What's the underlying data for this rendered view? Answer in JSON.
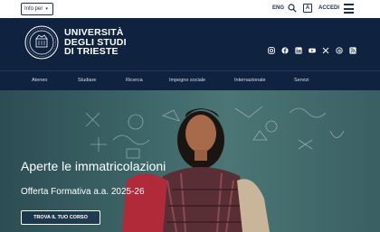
{
  "topbar": {
    "info_label": "Info per",
    "lang_label": "ENG",
    "access_label": "A",
    "login_label": "ACCEDI"
  },
  "header": {
    "brand_lines": [
      "UNIVERSITÀ",
      "DEGLI STUDI",
      "DI TRIESTE"
    ],
    "social_icons": [
      "instagram-icon",
      "facebook-icon",
      "linkedin-icon",
      "youtube-icon",
      "x-icon",
      "threads-icon",
      "rss-icon"
    ]
  },
  "nav": {
    "items": [
      "Ateneo",
      "Studiare",
      "Ricerca",
      "Impegno sociale",
      "Internazionale",
      "Servizi"
    ]
  },
  "hero": {
    "title": "Aperte le immatricolazioni",
    "subtitle": "Offerta Formativa a.a. 2025-26",
    "cta_label": "TROVA IL TUO CORSO"
  },
  "colors": {
    "navy": "#0f2341",
    "hero_teal": "#3b6466",
    "white": "#ffffff"
  }
}
